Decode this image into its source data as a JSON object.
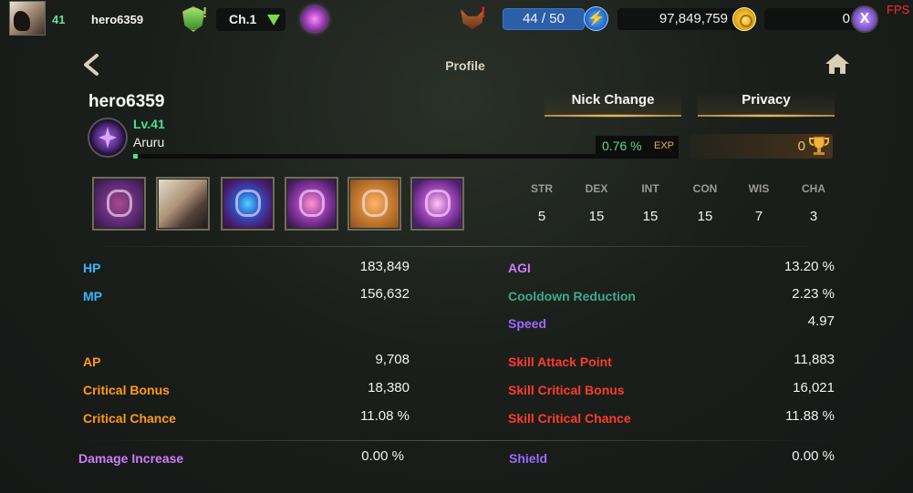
{
  "topbar": {
    "level": "41",
    "player_name": "hero6359",
    "channel": "Ch.1",
    "stamina": "44 / 50",
    "gold": "97,849,759",
    "premium": "0",
    "fps_label": "FPS"
  },
  "header": {
    "title": "Profile"
  },
  "profile": {
    "name": "hero6359",
    "level": "Lv.41",
    "class": "Aruru",
    "exp_percent": "0.76 %",
    "exp_label": "EXP",
    "exp_fraction": 0.0076,
    "nick_change": "Nick Change",
    "privacy": "Privacy",
    "trophies": "0"
  },
  "base_stats": [
    {
      "label": "STR",
      "value": "5"
    },
    {
      "label": "DEX",
      "value": "15"
    },
    {
      "label": "INT",
      "value": "15"
    },
    {
      "label": "CON",
      "value": "15"
    },
    {
      "label": "WIS",
      "value": "7"
    },
    {
      "label": "CHA",
      "value": "3"
    }
  ],
  "stats_left": {
    "hp": {
      "label": "HP",
      "value": "183,849"
    },
    "mp": {
      "label": "MP",
      "value": "156,632"
    },
    "ap": {
      "label": "AP",
      "value": "9,708"
    },
    "crit_bonus": {
      "label": "Critical Bonus",
      "value": "18,380"
    },
    "crit_chance": {
      "label": "Critical Chance",
      "value": "11.08 %"
    },
    "damage_increase": {
      "label": "Damage Increase",
      "value": "0.00 %"
    }
  },
  "stats_right": {
    "agi": {
      "label": "AGI",
      "value": "13.20 %"
    },
    "cooldown": {
      "label": "Cooldown Reduction",
      "value": "2.23 %"
    },
    "speed": {
      "label": "Speed",
      "value": "4.97"
    },
    "skill_ap": {
      "label": "Skill Attack Point",
      "value": "11,883"
    },
    "skill_crit_bonus": {
      "label": "Skill Critical Bonus",
      "value": "16,021"
    },
    "skill_crit_chance": {
      "label": "Skill Critical Chance",
      "value": "11.88 %"
    },
    "shield": {
      "label": "Shield",
      "value": "0.00 %"
    }
  },
  "colors": {
    "level_green": "#4fe08d",
    "hp_blue": "#33b7ff",
    "ap_orange": "#ff9a1a",
    "skill_red": "#ff3b2a",
    "agi_violet": "#cf7bff",
    "cooldown_teal": "#3fa88b",
    "stamina_blue": "#2c5fa8"
  },
  "icons": [
    "avatar",
    "shield-icon",
    "chevron-down-icon",
    "emblem-icon",
    "fox-icon",
    "bolt-icon",
    "coin-icon",
    "x-token-icon",
    "back-arrow-icon",
    "home-icon",
    "class-icon",
    "trophy-icon"
  ]
}
